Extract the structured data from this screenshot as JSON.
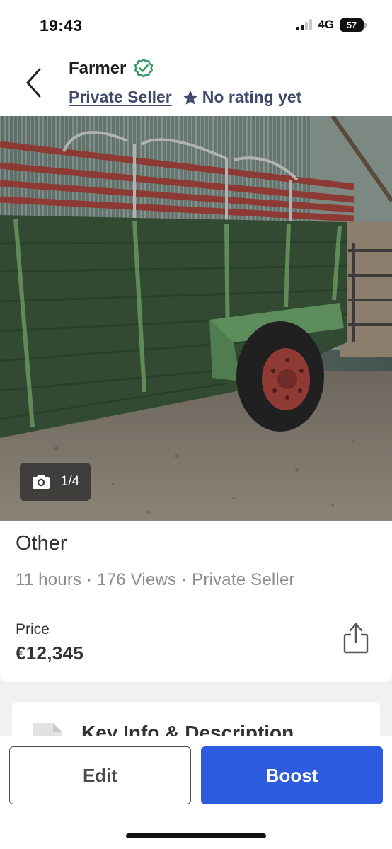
{
  "status_bar": {
    "time": "19:43",
    "network": "4G",
    "battery": "57",
    "signal_bars_active": 2,
    "signal_bars_total": 4,
    "battery_level_percent": 57
  },
  "header": {
    "back_icon": "chevron-left-icon",
    "seller_name": "Farmer",
    "verified_icon": "verified-badge-icon",
    "seller_type": "Private Seller",
    "rating_icon": "star-icon",
    "rating_text": "No rating yet"
  },
  "photo": {
    "camera_icon": "camera-icon",
    "counter": "1/4"
  },
  "listing": {
    "title": "Other",
    "meta": "11 hours · 176 Views · Private Seller",
    "price_label": "Price",
    "price": "€12,345",
    "share_icon": "share-icon"
  },
  "description": {
    "doc_icon": "document-icon",
    "title": "Key Info & Description"
  },
  "actions": {
    "edit_label": "Edit",
    "boost_label": "Boost"
  },
  "colors": {
    "accent": "#2d5ce0",
    "verified": "#2e9a5b",
    "seller_text": "#414a6b",
    "muted": "#8c8c8c"
  }
}
